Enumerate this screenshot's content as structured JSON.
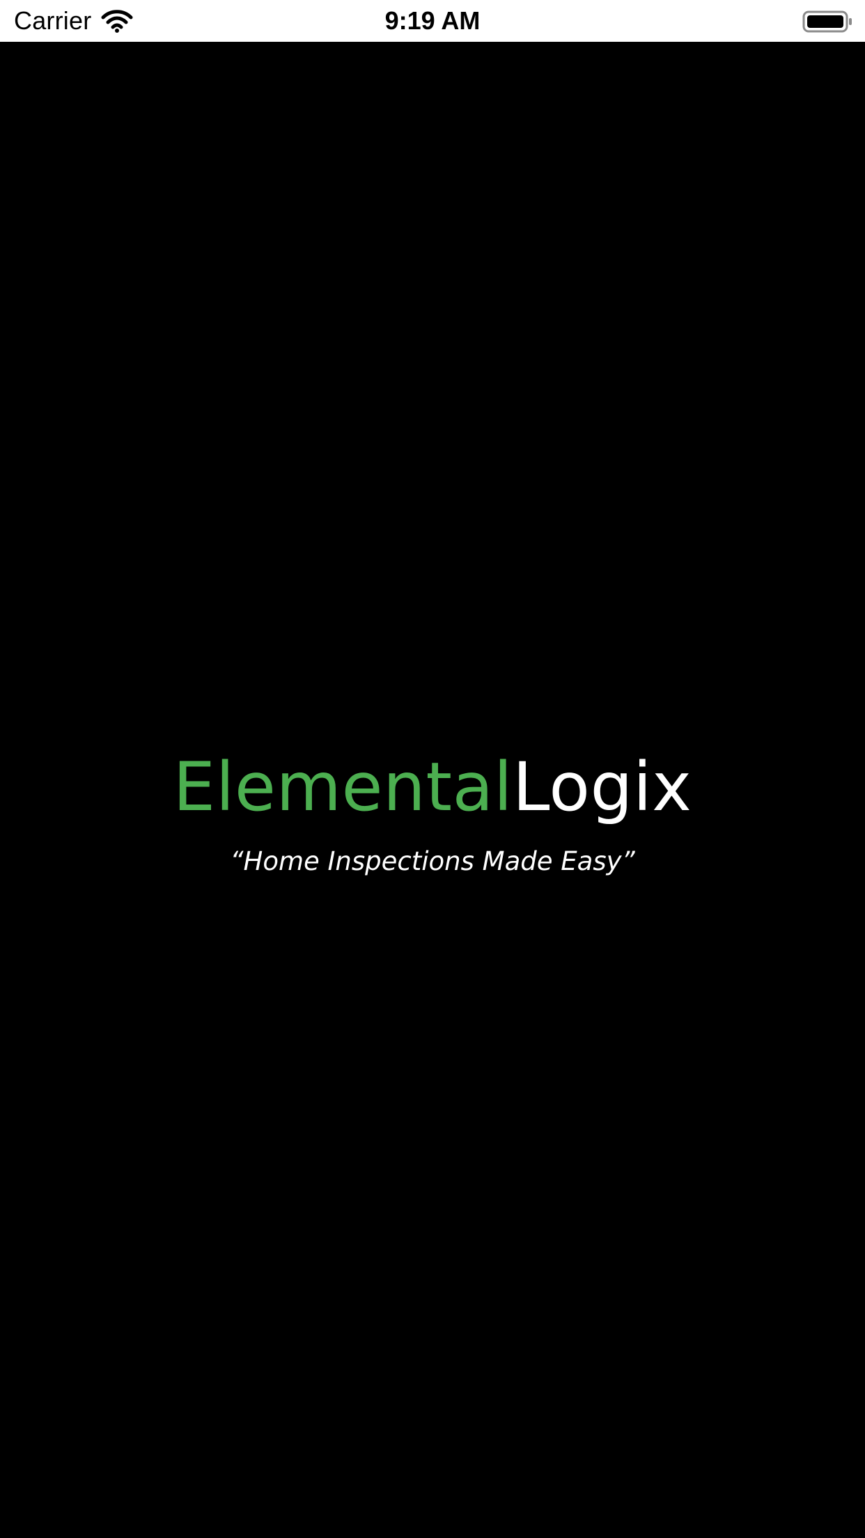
{
  "status_bar": {
    "carrier": "Carrier",
    "time": "9:19 AM",
    "wifi_icon": "wifi-icon",
    "battery_icon": "battery-icon",
    "background_color": "#ffffff",
    "text_color": "#000000"
  },
  "splash": {
    "logo_part_1": "Elemental",
    "logo_part_2": "Logix",
    "tagline": "“Home Inspections Made Easy”",
    "background_color": "#000000",
    "logo_accent_color": "#4caf50",
    "logo_text_color": "#ffffff"
  }
}
